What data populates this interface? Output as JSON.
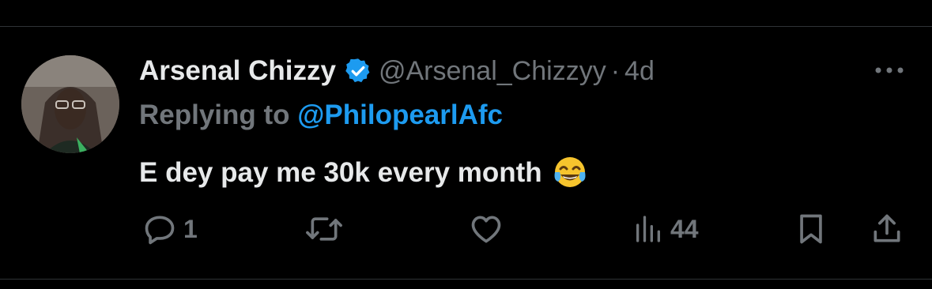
{
  "tweet": {
    "author": {
      "name": "Arsenal Chizzy",
      "handle": "@Arsenal_Chizzyy",
      "separator": "·",
      "timestamp": "4d",
      "verified_badge": "verified-badge-icon"
    },
    "replying": {
      "prefix": "Replying to ",
      "mention": "@PhilopearlAfc"
    },
    "text": "E dey pay me 30k every month",
    "emoji": "😂",
    "actions": {
      "reply": {
        "icon": "reply-icon",
        "count": "1"
      },
      "retweet": {
        "icon": "retweet-icon",
        "count": ""
      },
      "like": {
        "icon": "heart-icon",
        "count": ""
      },
      "views": {
        "icon": "views-icon",
        "count": "44"
      },
      "bookmark": {
        "icon": "bookmark-icon"
      },
      "share": {
        "icon": "share-icon"
      }
    }
  },
  "colors": {
    "background": "#000000",
    "text": "#e7e9ea",
    "secondary": "#71767b",
    "accent": "#1d9bf0",
    "divider": "#2f3336"
  }
}
